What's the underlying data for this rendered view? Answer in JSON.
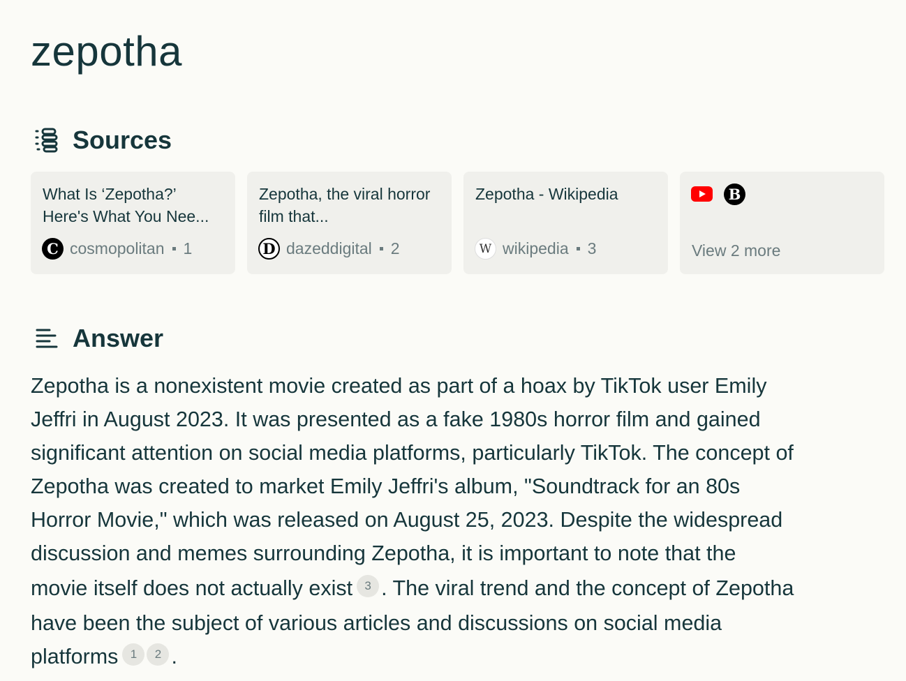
{
  "query": "zepotha",
  "sources_section": {
    "label": "Sources",
    "icon": "sources-list-icon",
    "cards": [
      {
        "title": "What Is ‘Zepotha?’ Here's What You Nee...",
        "favicon": "C",
        "site": "cosmopolitan",
        "index": "1"
      },
      {
        "title": "Zepotha, the viral horror film that...",
        "favicon": "D",
        "site": "dazeddigital",
        "index": "2"
      },
      {
        "title": "Zepotha - Wikipedia",
        "favicon": "W",
        "site": "wikipedia",
        "index": "3"
      }
    ],
    "more": {
      "label": "View 2 more",
      "icons": [
        "youtube-icon",
        "b-site-icon"
      ],
      "b_glyph": "B"
    }
  },
  "answer_section": {
    "label": "Answer",
    "icon": "answer-lines-icon",
    "lines": [
      "Zepotha is a nonexistent movie created as part of a hoax by TikTok user Emily",
      "Jeffri in August 2023. It was presented as a fake 1980s horror film and gained",
      "significant attention on social media platforms, particularly TikTok. The concept of",
      "Zepotha was created to market Emily Jeffri's album, \"Soundtrack for an 80s",
      "Horror Movie,\" which was released on August 25, 2023. Despite the widespread",
      "discussion and memes surrounding Zepotha, it is important to note that the"
    ],
    "line7_before": "movie itself does not actually exist",
    "line7_cite": "3",
    "line7_after": ". The viral trend and the concept of Zepotha",
    "line8": "have been the subject of various articles and discussions on social media",
    "line9_before": "platforms",
    "line9_cite1": "1",
    "line9_cite2": "2",
    "line9_after": "."
  },
  "colors": {
    "background": "#fbfbf7",
    "text": "#16363b",
    "muted": "#6a7b7e",
    "card": "#f0f0ec",
    "youtube": "#ff0000"
  }
}
